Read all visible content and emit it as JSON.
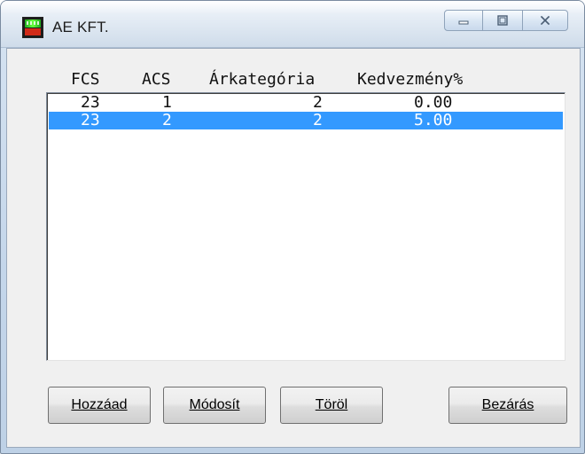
{
  "window": {
    "title": "AE KFT.",
    "icon": "app-icon"
  },
  "columns": [
    "FCS",
    "ACS",
    "Árkategória",
    "Kedvezmény%"
  ],
  "rows": [
    {
      "fcs": "23",
      "acs": "1",
      "arkategoria": "2",
      "kedvezmeny": "0.00",
      "selected": false
    },
    {
      "fcs": "23",
      "acs": "2",
      "arkategoria": "2",
      "kedvezmeny": "5.00",
      "selected": true
    }
  ],
  "buttons": {
    "add": "Hozzáad",
    "modify": "Módosít",
    "delete": "Töröl",
    "close": "Bezárás"
  },
  "colors": {
    "selection": "#3399ff",
    "list_bg": "#ffffff",
    "client_bg": "#f0f0f0"
  }
}
